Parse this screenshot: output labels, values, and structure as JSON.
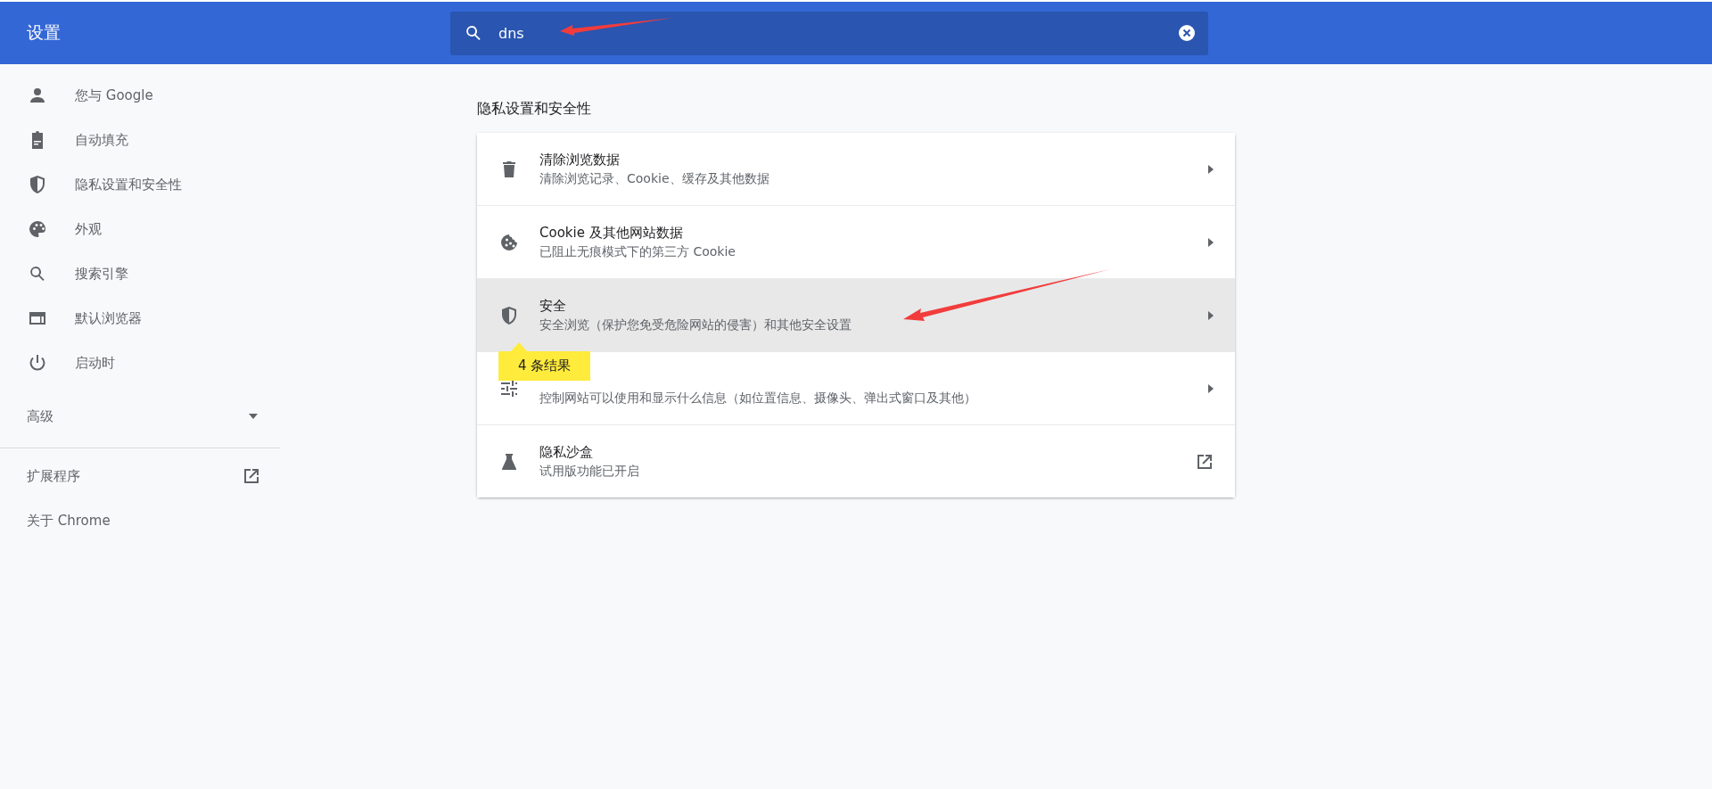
{
  "header": {
    "title": "设置",
    "search": {
      "value": "dns"
    }
  },
  "sidebar": {
    "items": [
      {
        "label": "您与 Google",
        "selected": false
      },
      {
        "label": "自动填充",
        "selected": false
      },
      {
        "label": "隐私设置和安全性",
        "selected": false
      },
      {
        "label": "外观",
        "selected": false
      },
      {
        "label": "搜索引擎",
        "selected": false
      },
      {
        "label": "默认浏览器",
        "selected": false
      },
      {
        "label": "启动时",
        "selected": false
      }
    ],
    "advanced": {
      "label": "高级",
      "expanded": false
    },
    "links": [
      {
        "label": "扩展程序",
        "external": true
      },
      {
        "label": "关于 Chrome",
        "external": false
      }
    ]
  },
  "section": {
    "title": "隐私设置和安全性",
    "rows": [
      {
        "title": "清除浏览数据",
        "subtitle": "清除浏览记录、Cookie、缓存及其他数据",
        "external": false,
        "highlighted": false
      },
      {
        "title": "Cookie 及其他网站数据",
        "subtitle": "已阻止无痕模式下的第三方 Cookie",
        "external": false,
        "highlighted": false
      },
      {
        "title": "安全",
        "subtitle": "安全浏览（保护您免受危险网站的侵害）和其他安全设置",
        "external": false,
        "highlighted": true
      },
      {
        "subtitle": "控制网站可以使用和显示什么信息（如位置信息、摄像头、弹出式窗口及其他）",
        "external": false,
        "highlighted": false
      },
      {
        "title": "隐私沙盒",
        "subtitle": "试用版功能已开启",
        "external": true,
        "highlighted": false
      }
    ],
    "badge": "4 条结果"
  }
}
